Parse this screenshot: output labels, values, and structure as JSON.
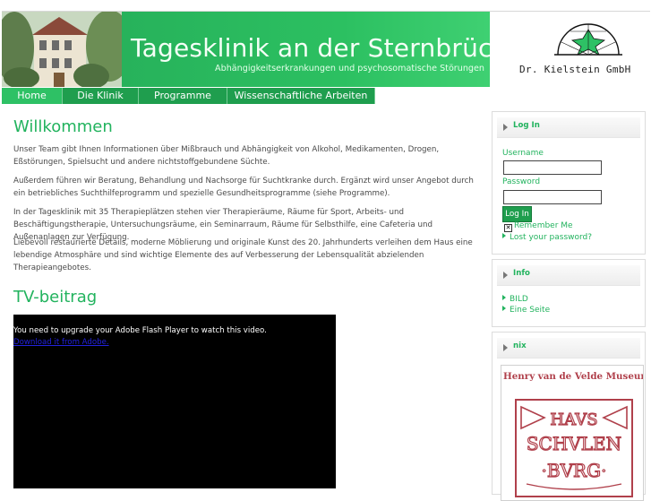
{
  "header": {
    "title": "Tagesklinik an der Sternbrücke",
    "subtitle": "Abhängigkeitserkrankungen und psychosomatische Störungen",
    "company": "Dr. Kielstein GmbH"
  },
  "nav": {
    "items": [
      {
        "label": "Home",
        "active": true
      },
      {
        "label": "Die Klinik",
        "active": false
      },
      {
        "label": "Programme",
        "active": false
      },
      {
        "label": "Wissenschaftliche Arbeiten",
        "active": false
      }
    ]
  },
  "main": {
    "welcome_title": "Willkommen",
    "paragraphs": [
      "Unser Team gibt Ihnen Informationen über Mißbrauch und Abhängigkeit von Alkohol, Medikamenten, Drogen, Eßstörungen, Spielsucht und andere nichtstoffgebundene Süchte.",
      "Außerdem führen wir Beratung, Behandlung und Nachsorge für Suchtkranke durch. Ergänzt wird unser Angebot durch ein betriebliches Suchthilfeprogramm und spezielle Gesundheitsprogramme (siehe Programme).",
      "In der Tagesklinik mit 35 Therapieplätzen stehen vier Therapieräume, Räume für Sport, Arbeits- und Beschäftigungstherapie, Untersuchungsräume, ein Seminarraum, Räume für Selbsthilfe, eine Cafeteria und Außenanlagen zur Verfügung.",
      "Liebevoll restaurierte Details, moderne Möblierung und originale Kunst des 20. Jahrhunderts verleihen dem Haus eine lebendige Atmosphäre und sind wichtige Elemente des auf Verbesserung der Lebensqualität abzielenden Therapieangebotes."
    ],
    "tv_title": "TV-beitrag",
    "video_message": "You need to upgrade your Adobe Flash Player to watch this video.",
    "video_link": "Download it from Adobe."
  },
  "sidebar": {
    "login": {
      "title": "Log In",
      "username_label": "Username",
      "username_value": "",
      "password_label": "Password",
      "password_value": "",
      "button": "Log In",
      "remember": "Remember Me",
      "remember_checked": true,
      "lost_password": "Lost your password?"
    },
    "info": {
      "title": "Info",
      "links": [
        "BILD",
        "Eine Seite"
      ]
    },
    "nix": {
      "title": "nix",
      "museum_title": "Henry van de Velde Museum",
      "stamp_text": "HAVS SCHVLEN BVRG"
    }
  },
  "colors": {
    "brand_green": "#22b35e",
    "nav_green": "#1f9e4e",
    "nav_active": "#2ec165",
    "museum_red": "#b0404b"
  }
}
